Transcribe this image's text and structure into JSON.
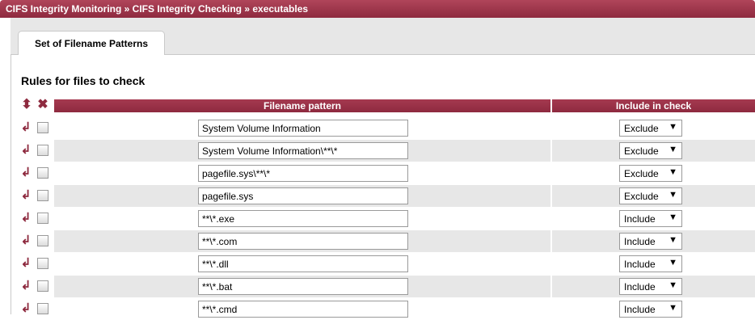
{
  "breadcrumb": "CIFS Integrity Monitoring » CIFS Integrity Checking » executables",
  "tab": {
    "label": "Set of Filename Patterns"
  },
  "section_title": "Rules for files to check",
  "header": {
    "move_icon": "move-arrow-icon",
    "delete_icon": "delete-x-icon",
    "pattern_label": "Filename pattern",
    "include_label": "Include in check"
  },
  "colors": {
    "accent": "#8e2a3f",
    "row_alt": "#e7e7e7"
  },
  "rows": [
    {
      "pattern": "System Volume Information",
      "include": "Exclude"
    },
    {
      "pattern": "System Volume Information\\**\\*",
      "include": "Exclude"
    },
    {
      "pattern": "pagefile.sys\\**\\*",
      "include": "Exclude"
    },
    {
      "pattern": "pagefile.sys",
      "include": "Exclude"
    },
    {
      "pattern": "**\\*.exe",
      "include": "Include"
    },
    {
      "pattern": "**\\*.com",
      "include": "Include"
    },
    {
      "pattern": "**\\*.dll",
      "include": "Include"
    },
    {
      "pattern": "**\\*.bat",
      "include": "Include"
    },
    {
      "pattern": "**\\*.cmd",
      "include": "Include"
    }
  ]
}
